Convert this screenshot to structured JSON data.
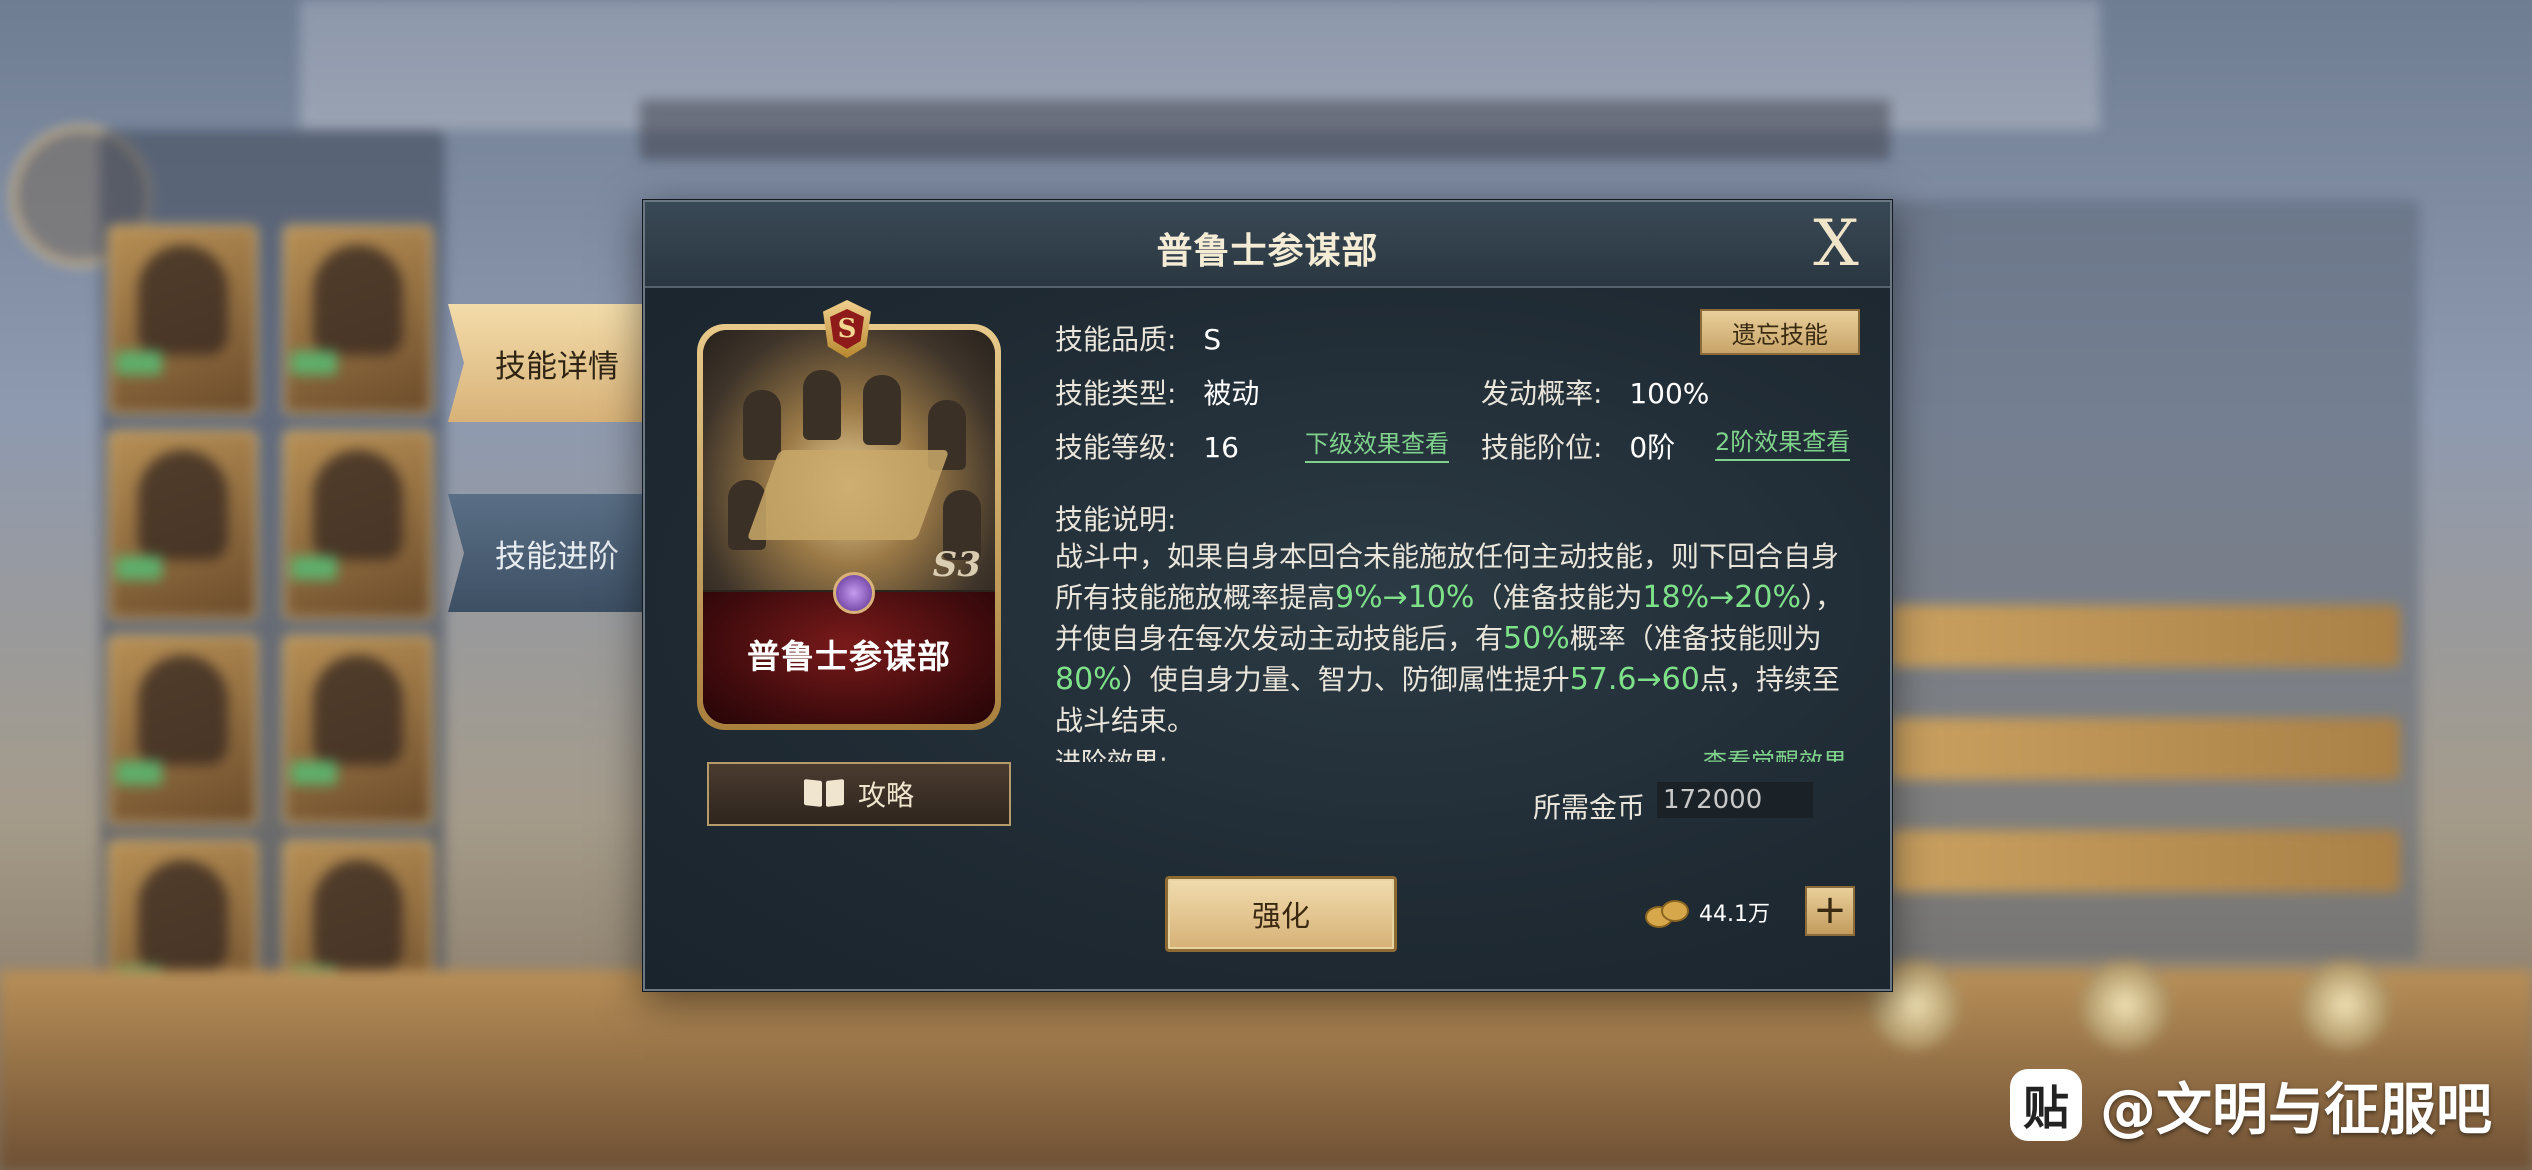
{
  "watermark": {
    "logo": "贴",
    "text": "@文明与征服吧"
  },
  "side_tabs": [
    {
      "label": "技能详情",
      "active": true
    },
    {
      "label": "技能进阶",
      "active": false
    }
  ],
  "modal": {
    "title": "普鲁士参谋部",
    "close_label": "X",
    "card": {
      "name": "普鲁士参谋部",
      "quality_badge": "S",
      "level_mark": "S3"
    },
    "guide_label": "攻略",
    "forget_label": "遗忘技能",
    "fields": {
      "quality_label": "技能品质:",
      "quality_value": "S",
      "type_label": "技能类型:",
      "type_value": "被动",
      "rate_label": "发动概率:",
      "rate_value": "100%",
      "level_label": "技能等级:",
      "level_value": "16",
      "stage_label": "技能阶位:",
      "stage_value": "0阶",
      "next_level_link": "下级效果查看",
      "stage2_link": "2阶效果查看"
    },
    "description": {
      "title": "技能说明:",
      "p1": "战斗中，如果自身本回合未能施放任何主动技能，则下回合自身所有技能施放概率提高",
      "h1": "9%→10%",
      "p2": "（准备技能为",
      "h2": "18%→20%",
      "p3": "），并使自身在每次发动主动技能后，有",
      "h3": "50%",
      "p4": "概率（准备技能则为",
      "h4": "80%",
      "p5": "）使自身力量、智力、防御属性提升",
      "h5": "57.6→60",
      "p6": "点，持续至战斗结束。"
    },
    "advance_label": "进阶效果:",
    "awaken_link": "查看觉醒效果",
    "cost_label": "所需金币",
    "cost_value": "172000",
    "enhance_label": "强化",
    "coins_value": "44.1万",
    "plus_label": "+"
  }
}
